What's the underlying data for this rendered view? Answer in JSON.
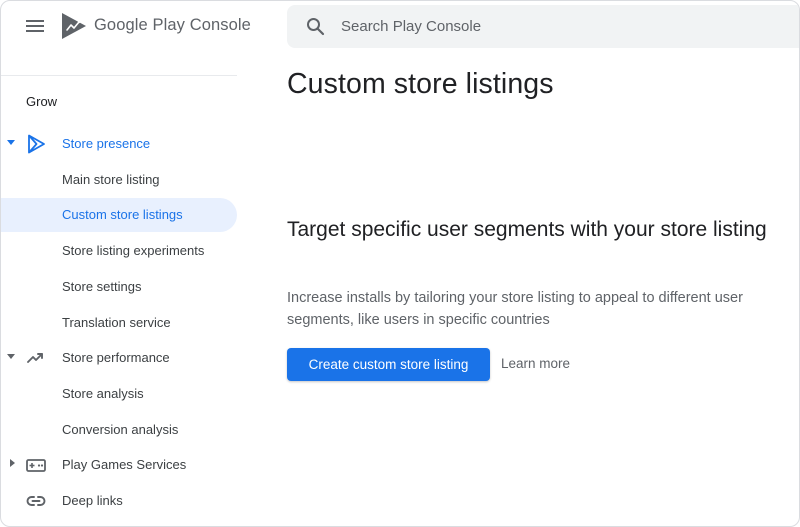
{
  "header": {
    "brand_google": "Google Play",
    "brand_console": "Console",
    "search_placeholder": "Search Play Console"
  },
  "sidebar": {
    "section_heading": "Grow",
    "items": [
      {
        "label": "Store presence",
        "level": "group",
        "expanded": true,
        "active": true,
        "icon": "play-outline-icon"
      },
      {
        "label": "Main store listing",
        "level": "child"
      },
      {
        "label": "Custom store listings",
        "level": "child",
        "selected": true
      },
      {
        "label": "Store listing experiments",
        "level": "child"
      },
      {
        "label": "Store settings",
        "level": "child"
      },
      {
        "label": "Translation service",
        "level": "child"
      },
      {
        "label": "Store performance",
        "level": "group",
        "expanded": true,
        "icon": "trending-up-icon"
      },
      {
        "label": "Store analysis",
        "level": "child"
      },
      {
        "label": "Conversion analysis",
        "level": "child"
      },
      {
        "label": "Play Games Services",
        "level": "group",
        "expanded": false,
        "icon": "gamepad-icon"
      },
      {
        "label": "Deep links",
        "level": "group",
        "icon": "link-icon"
      }
    ]
  },
  "main": {
    "page_title": "Custom store listings",
    "section_title": "Target specific user segments with your store listing",
    "description": "Increase installs by tailoring your store listing to appeal to different user segments, like users in specific countries",
    "primary_button_label": "Create custom store listing",
    "learn_more_label": "Learn more"
  },
  "colors": {
    "accent": "#1a73e8",
    "selected_background": "#e8f0fe",
    "search_background": "#f1f3f4",
    "text_primary": "#202124",
    "text_secondary": "#5f6368"
  }
}
